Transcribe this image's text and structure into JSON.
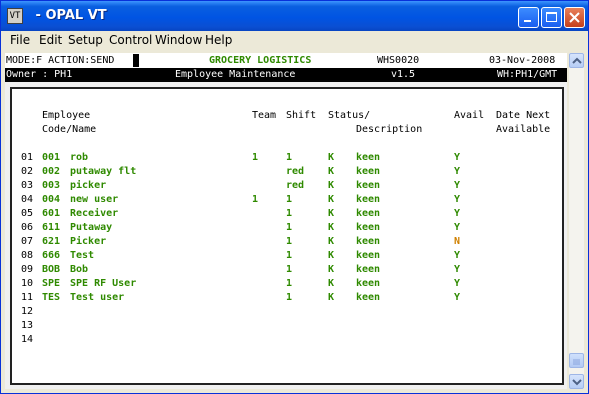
{
  "window": {
    "title": " - OPAL VT",
    "icon_label": "VT",
    "buttons": [
      "minimize",
      "maximize",
      "close"
    ]
  },
  "menubar": {
    "items": [
      {
        "label": "File"
      },
      {
        "label": "Edit"
      },
      {
        "label": "Setup"
      },
      {
        "label": "Control"
      },
      {
        "label": "Window"
      },
      {
        "label": "Help"
      }
    ]
  },
  "statusbar": {
    "mode": "MODE:F ACTION:SEND",
    "title": "GROCERY LOGISTICS",
    "program": "WHS0020",
    "date": "03-Nov-2008"
  },
  "ownerbar": {
    "owner": "Owner : PH1",
    "screen_title": "Employee Maintenance",
    "version": "v1.5",
    "warehouse": "WH:PH1/GMT"
  },
  "table": {
    "headers": {
      "employee": "Employee",
      "code_name": "Code/Name",
      "team": "Team",
      "shift": "Shift",
      "status": "Status/",
      "description": "Description",
      "avail": "Avail",
      "date_next": "Date Next",
      "available": "Available"
    },
    "rows": [
      {
        "num": "01",
        "code": "001",
        "name": "rob",
        "team": "1",
        "shift": "1",
        "status": "K",
        "desc": "keen",
        "avail": "Y"
      },
      {
        "num": "02",
        "code": "002",
        "name": "putaway flt",
        "team": "",
        "shift": "red",
        "status": "K",
        "desc": "keen",
        "avail": "Y"
      },
      {
        "num": "03",
        "code": "003",
        "name": "picker",
        "team": "",
        "shift": "red",
        "status": "K",
        "desc": "keen",
        "avail": "Y"
      },
      {
        "num": "04",
        "code": "004",
        "name": "new user",
        "team": "1",
        "shift": "1",
        "status": "K",
        "desc": "keen",
        "avail": "Y"
      },
      {
        "num": "05",
        "code": "601",
        "name": "Receiver",
        "team": "",
        "shift": "1",
        "status": "K",
        "desc": "keen",
        "avail": "Y"
      },
      {
        "num": "06",
        "code": "611",
        "name": "Putaway",
        "team": "",
        "shift": "1",
        "status": "K",
        "desc": "keen",
        "avail": "Y"
      },
      {
        "num": "07",
        "code": "621",
        "name": "Picker",
        "team": "",
        "shift": "1",
        "status": "K",
        "desc": "keen",
        "avail": "N"
      },
      {
        "num": "08",
        "code": "666",
        "name": "Test",
        "team": "",
        "shift": "1",
        "status": "K",
        "desc": "keen",
        "avail": "Y"
      },
      {
        "num": "09",
        "code": "BOB",
        "name": "Bob",
        "team": "",
        "shift": "1",
        "status": "K",
        "desc": "keen",
        "avail": "Y"
      },
      {
        "num": "10",
        "code": "SPE",
        "name": "SPE RF User",
        "team": "",
        "shift": "1",
        "status": "K",
        "desc": "keen",
        "avail": "Y"
      },
      {
        "num": "11",
        "code": "TES",
        "name": "Test user",
        "team": "",
        "shift": "1",
        "status": "K",
        "desc": "keen",
        "avail": "Y"
      },
      {
        "num": "12",
        "code": "",
        "name": "",
        "team": "",
        "shift": "",
        "status": "",
        "desc": "",
        "avail": ""
      },
      {
        "num": "13",
        "code": "",
        "name": "",
        "team": "",
        "shift": "",
        "status": "",
        "desc": "",
        "avail": ""
      },
      {
        "num": "14",
        "code": "",
        "name": "",
        "team": "",
        "shift": "",
        "status": "",
        "desc": "",
        "avail": ""
      }
    ]
  },
  "colors": {
    "field_green": "#2f8a00",
    "field_orange": "#d08000",
    "title_green": "#2f8a00"
  }
}
